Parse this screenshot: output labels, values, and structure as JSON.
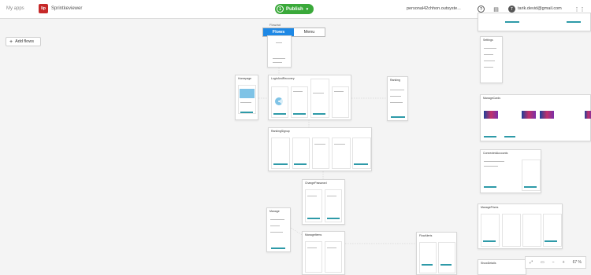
{
  "topbar": {
    "breadcrumb": "My apps",
    "app_badge": "lip",
    "app_name": "Sprintkeviewer",
    "publish_label": "Publish",
    "account": "personal42chhon.outsyste...",
    "user_email": "tarik.devid@gmail.com"
  },
  "toolbar": {
    "add_flows_label": "Add flows",
    "segment_caption": "Flow/ad",
    "tab_flows": "Flows",
    "tab_menu": "Menu"
  },
  "nodes": {
    "login": "LoginAndRecovery",
    "homepage": "Homepage",
    "ranking": "Ranking",
    "ranking_signup": "RankingSignup",
    "change_password": "ChangePassword",
    "manage": "Manage",
    "manage_items": "ManageItems",
    "flow_alerts": "FlowAlerts",
    "settings": "Settings",
    "manage_cards": "ManageCards",
    "connected_accounts": "ConnectedAccounts",
    "manage_prizes": "ManagePrizes",
    "show_details": "ShowDetails"
  },
  "zoom": {
    "level": "67 %",
    "minus": "−",
    "plus": "+"
  },
  "icons": {
    "help": "help-icon",
    "chat": "chat-icon",
    "grid": "apps-grid-icon"
  }
}
